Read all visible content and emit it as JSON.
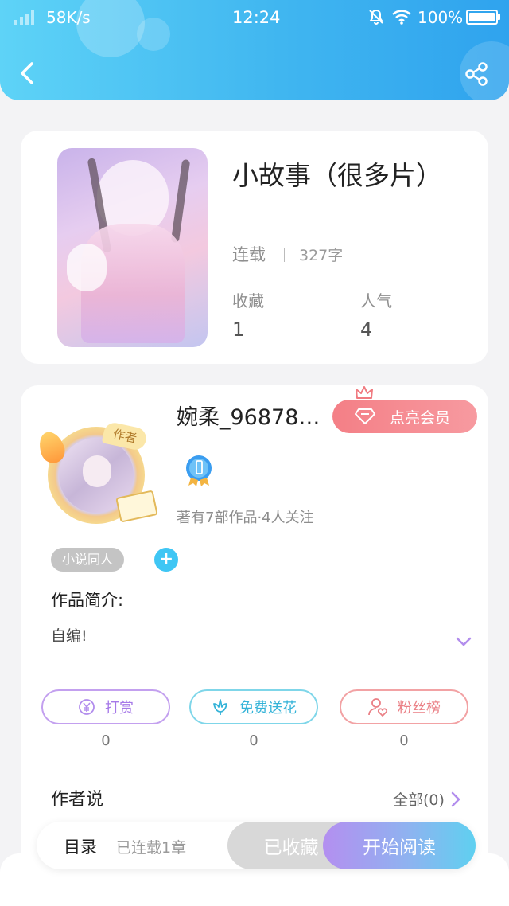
{
  "status_bar": {
    "network_speed": "58K/s",
    "time": "12:24",
    "battery": "100%"
  },
  "book": {
    "title": "小故事（很多片）",
    "status": "连载",
    "word_count": "327字",
    "favorites_label": "收藏",
    "favorites_value": "1",
    "popularity_label": "人气",
    "popularity_value": "4"
  },
  "author": {
    "avatar_tag": "作者",
    "name": "婉柔_96878…",
    "vip_button": "点亮会员",
    "stats": "著有7部作品·4人关注",
    "tag": "小说同人",
    "intro_label": "作品简介:",
    "intro_text": "自编!"
  },
  "actions": [
    {
      "label": "打赏",
      "value": "0",
      "icon": "yen-icon"
    },
    {
      "label": "免费送花",
      "value": "0",
      "icon": "flower-icon"
    },
    {
      "label": "粉丝榜",
      "value": "0",
      "icon": "fan-icon"
    }
  ],
  "author_says": {
    "label": "作者说",
    "all": "全部(0)"
  },
  "bottom_bar": {
    "toc": "目录",
    "chapters": "已连载1章",
    "collected": "已收藏",
    "read": "开始阅读"
  },
  "colors": {
    "header_gradient": [
      "#5ed3f7",
      "#2fa3ee"
    ],
    "vip_pink": "#f47f86",
    "tip_purple": "#a679e8",
    "flower_cyan": "#34b3d8",
    "fans_red": "#ea7f85"
  }
}
